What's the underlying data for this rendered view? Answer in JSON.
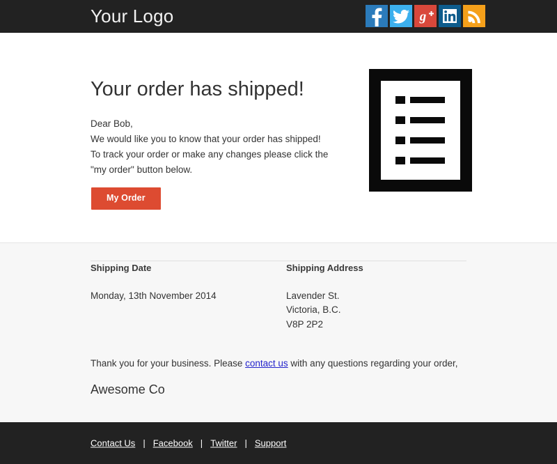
{
  "header": {
    "logo": "Your Logo",
    "social": [
      {
        "name": "facebook-icon",
        "label": "Facebook",
        "glyph": "f",
        "color": "#2b7bbb"
      },
      {
        "name": "twitter-icon",
        "label": "Twitter",
        "glyph": "t",
        "color": "#3cb0ee"
      },
      {
        "name": "google-plus-icon",
        "label": "Google Plus",
        "glyph": "g+",
        "color": "#d9483b"
      },
      {
        "name": "linkedin-icon",
        "label": "LinkedIn",
        "glyph": "in",
        "color": "#0e5c8c"
      },
      {
        "name": "rss-icon",
        "label": "RSS",
        "glyph": "rss",
        "color": "#f5a01a"
      }
    ]
  },
  "main": {
    "headline": "Your order has shipped!",
    "greeting": "Dear Bob,",
    "body": "We would like you to know that your order has shipped! To track your order or make any changes please click the \"my order\" button below.",
    "cta_label": "My Order",
    "cta_color": "#dd4b31",
    "hero_icon": "order-list-document-icon"
  },
  "details": {
    "shipping_date_heading": "Shipping Date",
    "shipping_date_value": "Monday, 13th November 2014",
    "shipping_address_heading": "Shipping Address",
    "shipping_address_lines": [
      "Lavender St.",
      "Victoria, B.C.",
      "V8P 2P2"
    ],
    "closing_before_link": "Thank you for your business. Please ",
    "closing_link": "contact us",
    "closing_after_link": " with any questions regarding your order,",
    "signature": "Awesome Co"
  },
  "footer": {
    "links": [
      "Contact Us",
      "Facebook",
      "Twitter",
      "Support"
    ],
    "separator": "|"
  }
}
